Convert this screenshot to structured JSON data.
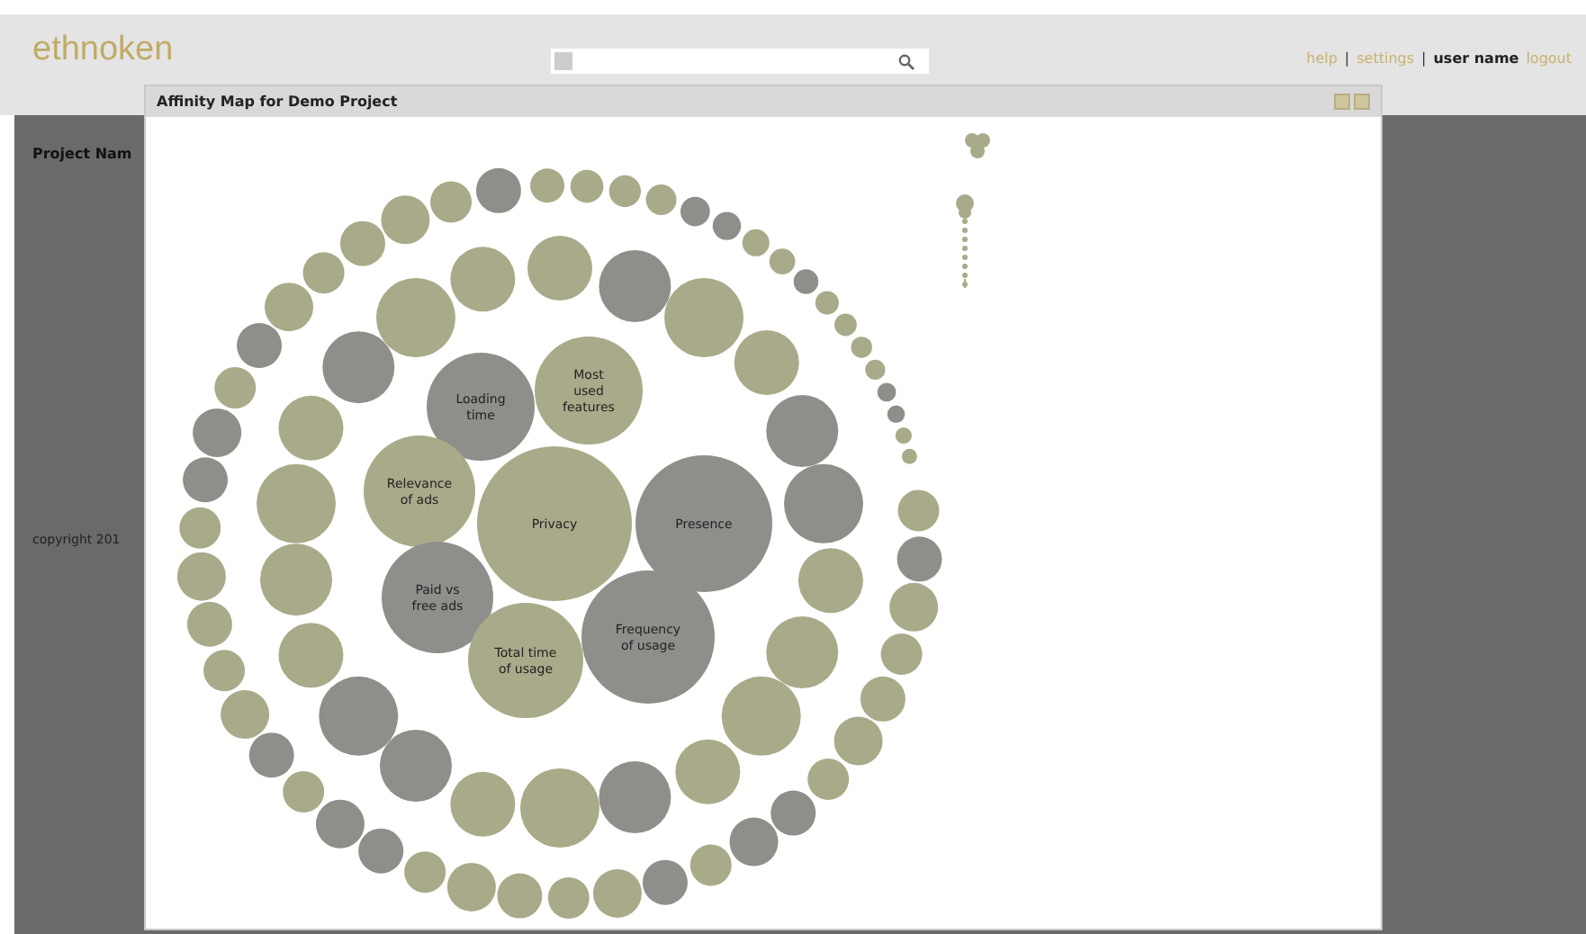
{
  "header": {
    "logo": "ethnoken",
    "nav": [
      {
        "text": "help",
        "kind": "link"
      },
      {
        "text": "|",
        "kind": "separator"
      },
      {
        "text": "settings",
        "kind": "link"
      },
      {
        "text": "|",
        "kind": "separator"
      },
      {
        "text": "user name",
        "kind": "user"
      },
      {
        "text": "logout",
        "kind": "link"
      }
    ]
  },
  "sidebar": {
    "heading": "Project Nam"
  },
  "footer": {
    "copyright": "copyright 201"
  },
  "dialog": {
    "title": "Affinity Map for Demo Project",
    "bubbles": [
      {
        "lines": [
          "Loading",
          "time"
        ],
        "color": "#8e8f8a"
      },
      {
        "lines": [
          "Most",
          "used",
          "features"
        ],
        "color": "#a9aa89"
      },
      {
        "lines": [
          "Relevance",
          "of ads"
        ],
        "color": "#a9aa89"
      },
      {
        "lines": [
          "Privacy"
        ],
        "color": "#a9aa89"
      },
      {
        "lines": [
          "Presence"
        ],
        "color": "#8e8f8a"
      },
      {
        "lines": [
          "Paid vs",
          "free ads"
        ],
        "color": "#8e8f8a"
      },
      {
        "lines": [
          "Total time",
          "of usage"
        ],
        "color": "#a9aa89"
      },
      {
        "lines": [
          "Frequency",
          "of usage"
        ],
        "color": "#8e8f8a"
      }
    ]
  }
}
